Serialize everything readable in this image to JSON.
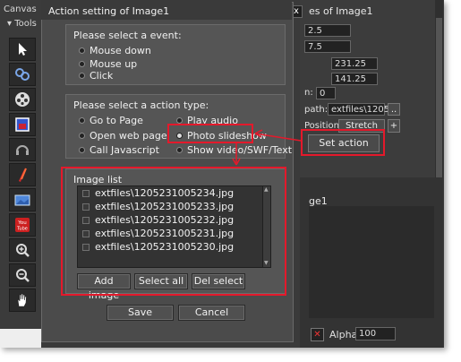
{
  "canvas_header": {
    "canvas": "Canvas",
    "tools": "Tools"
  },
  "tools": [
    {
      "icon": "arrow-pointer-icon"
    },
    {
      "icon": "link-icon"
    },
    {
      "icon": "film-reel-icon"
    },
    {
      "icon": "image-frame-icon"
    },
    {
      "icon": "headphones-icon"
    },
    {
      "icon": "flash-icon"
    },
    {
      "icon": "picture-icon"
    },
    {
      "icon": "youtube-icon",
      "text_you": "You",
      "text_tube": "Tube"
    },
    {
      "icon": "zoom-in-icon"
    },
    {
      "icon": "zoom-out-icon"
    },
    {
      "icon": "hand-icon"
    }
  ],
  "dialog": {
    "title": "Action setting of Image1",
    "event_group": {
      "title": "Please select a event:",
      "options": [
        "Mouse down",
        "Mouse up",
        "Click"
      ]
    },
    "action_group": {
      "title": "Please select a action type:",
      "options_left": [
        "Go to Page",
        "Open web page",
        "Call Javascript"
      ],
      "options_right": [
        "Play audio",
        "Photo slideshow",
        "Show video/SWF/Text"
      ],
      "selected": "Photo slideshow"
    },
    "image_list": {
      "title": "Image list",
      "items": [
        "extfiles\\1205231005234.jpg",
        "extfiles\\1205231005233.jpg",
        "extfiles\\1205231005232.jpg",
        "extfiles\\1205231005231.jpg",
        "extfiles\\1205231005230.jpg"
      ],
      "buttons": {
        "add": "Add image",
        "select_all": "Select all",
        "del_select": "Del select"
      }
    },
    "footer": {
      "save": "Save",
      "cancel": "Cancel"
    }
  },
  "right_panel": {
    "title": "es of Image1",
    "fields": [
      "2.5",
      "7.5",
      "231.25",
      "141.25",
      "0"
    ],
    "field_label_n": "n:",
    "path_label": "path:",
    "path_value": "extfiles\\12052",
    "path_btn": "..",
    "position_label": "Position:",
    "position_value": "Stretch",
    "plus_btn": "+",
    "set_action": "Set action",
    "lower_title": "ge1",
    "alpha_label": "Alpha:",
    "alpha_value": "100"
  },
  "colors": {
    "highlight": "#e4192b"
  }
}
